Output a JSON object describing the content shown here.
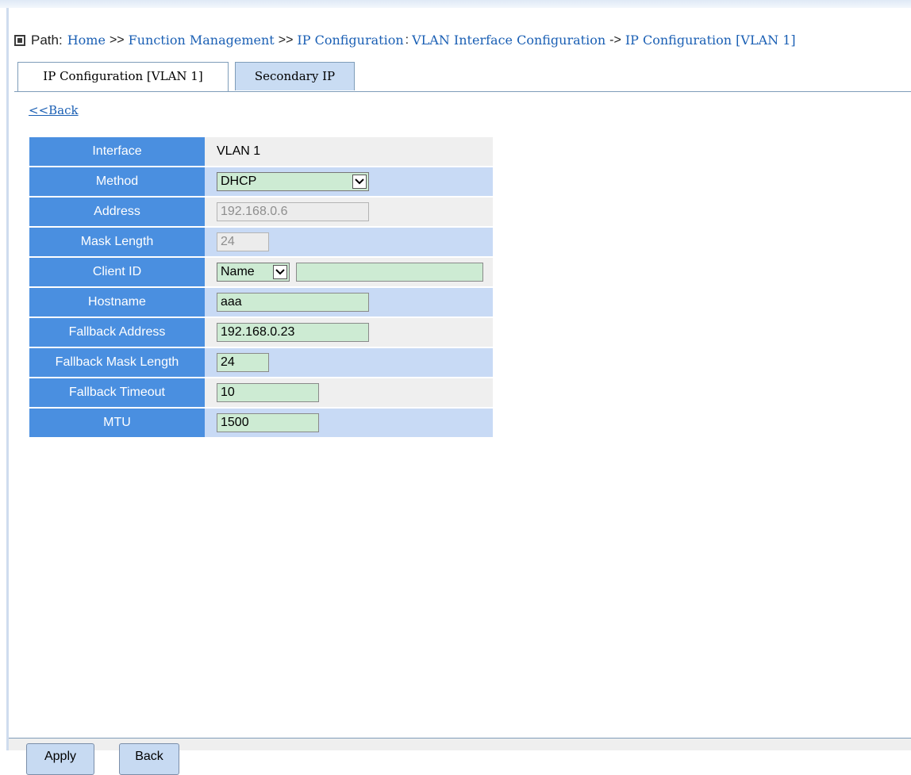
{
  "path": {
    "label": "Path:",
    "crumbs": [
      "Home",
      ">>",
      "Function Management",
      ">>",
      "IP Configuration",
      ":",
      "VLAN Interface Configuration",
      "->",
      "IP Configuration [VLAN 1]"
    ]
  },
  "tabs": [
    {
      "label": "IP Configuration [VLAN 1]",
      "active": true
    },
    {
      "label": "Secondary IP",
      "active": false
    }
  ],
  "back_link": "<<Back",
  "form": {
    "interface": {
      "label": "Interface",
      "value": "VLAN 1"
    },
    "method": {
      "label": "Method",
      "value": "DHCP"
    },
    "address": {
      "label": "Address",
      "value": "192.168.0.6"
    },
    "mask_length": {
      "label": "Mask Length",
      "value": "24"
    },
    "client_id": {
      "label": "Client ID",
      "type_value": "Name",
      "value": ""
    },
    "hostname": {
      "label": "Hostname",
      "value": "aaa"
    },
    "fallback_address": {
      "label": "Fallback Address",
      "value": "192.168.0.23"
    },
    "fallback_mask_length": {
      "label": "Fallback Mask Length",
      "value": "24"
    },
    "fallback_timeout": {
      "label": "Fallback Timeout",
      "value": "10"
    },
    "mtu": {
      "label": "MTU",
      "value": "1500"
    }
  },
  "buttons": {
    "apply": "Apply",
    "back": "Back"
  },
  "colors": {
    "label_bg": "#4a8fe0",
    "row_blue": "#c8daf5",
    "row_gray": "#efefef",
    "input_green": "#cdebd3",
    "link": "#1a5fb4"
  }
}
